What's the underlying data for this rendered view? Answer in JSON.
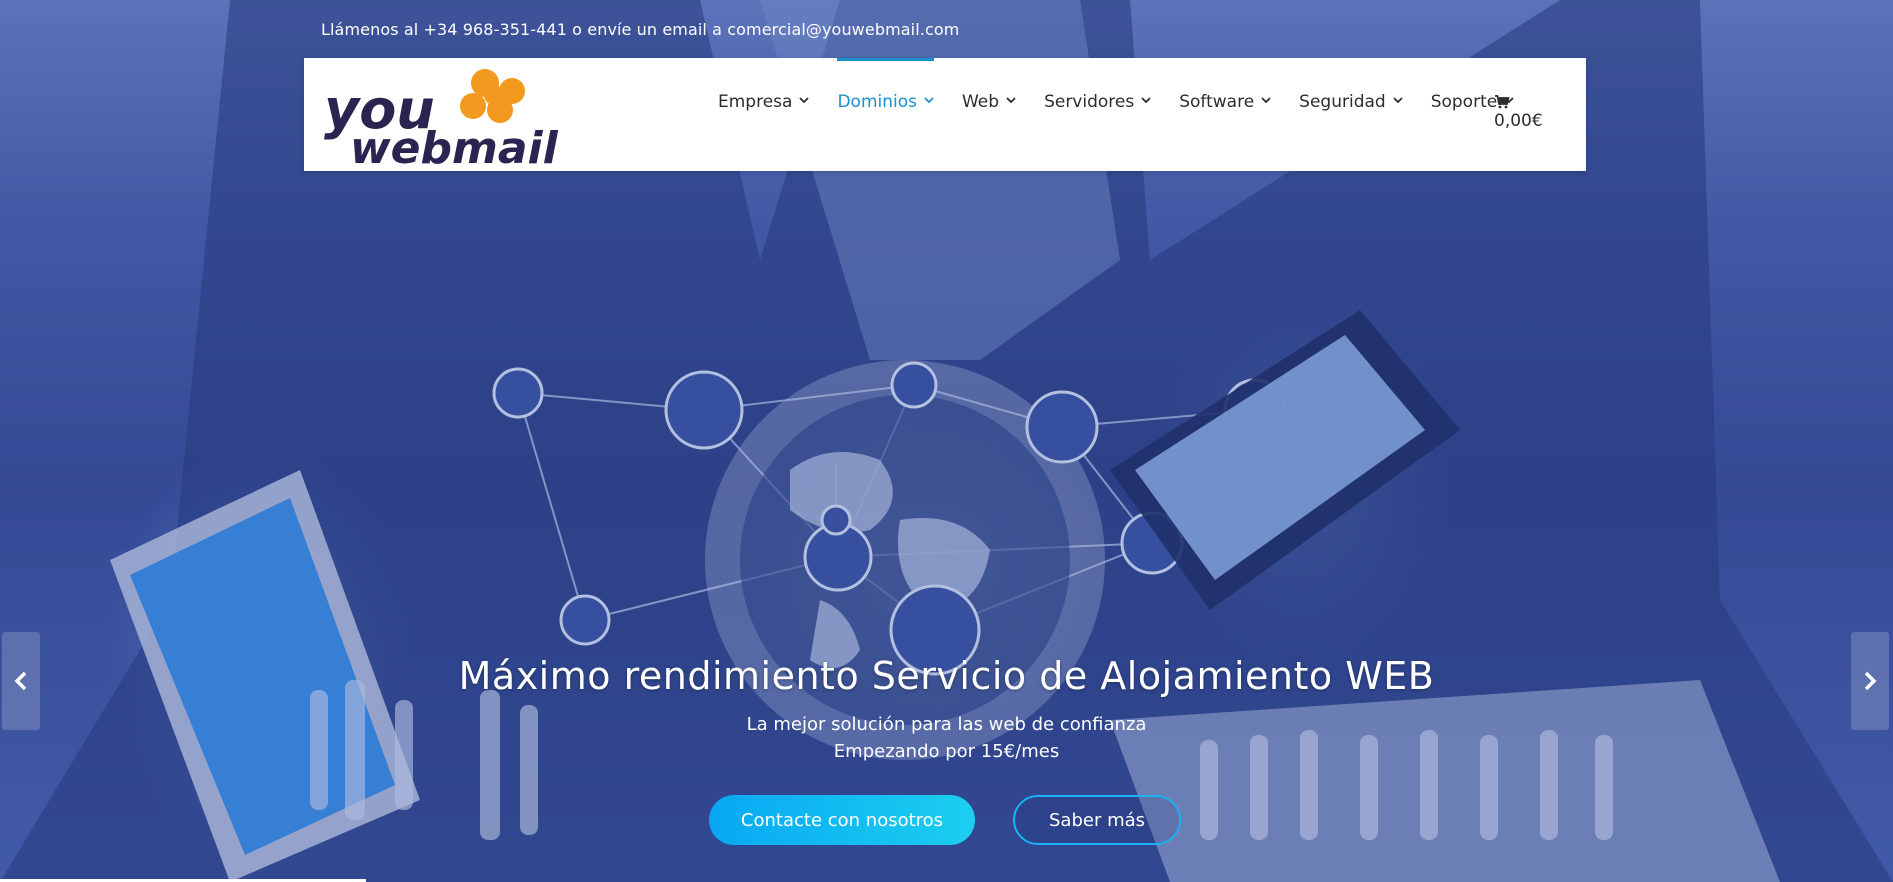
{
  "topbar": {
    "text": "Llámenos al +34 968-351-441 o envíe un email a comercial@youwebmail.com"
  },
  "logo": {
    "line1": "you",
    "line2": "webmail",
    "text_color": "#2a2550",
    "flower_color": "#f29a1f"
  },
  "nav": {
    "items": [
      {
        "label": "Empresa",
        "active": false
      },
      {
        "label": "Dominios",
        "active": true
      },
      {
        "label": "Web",
        "active": false
      },
      {
        "label": "Servidores",
        "active": false
      },
      {
        "label": "Software",
        "active": false
      },
      {
        "label": "Seguridad",
        "active": false
      },
      {
        "label": "Soporte",
        "active": false
      }
    ],
    "active_color": "#1a8fd0",
    "cart": {
      "total": "0,00€",
      "icon": "shopping-cart-icon"
    }
  },
  "slide": {
    "title": "Máximo rendimiento Servicio de Alojamiento WEB",
    "subtitle_line1": "La mejor solución para las web de confianza",
    "subtitle_line2": "Empezando por 15€/mes",
    "primary_button": "Contacte con nosotros",
    "secondary_button": "Saber más",
    "primary_color": "#07a8f2"
  },
  "slider_controls": {
    "prev_icon": "chevron-left-icon",
    "next_icon": "chevron-right-icon"
  }
}
